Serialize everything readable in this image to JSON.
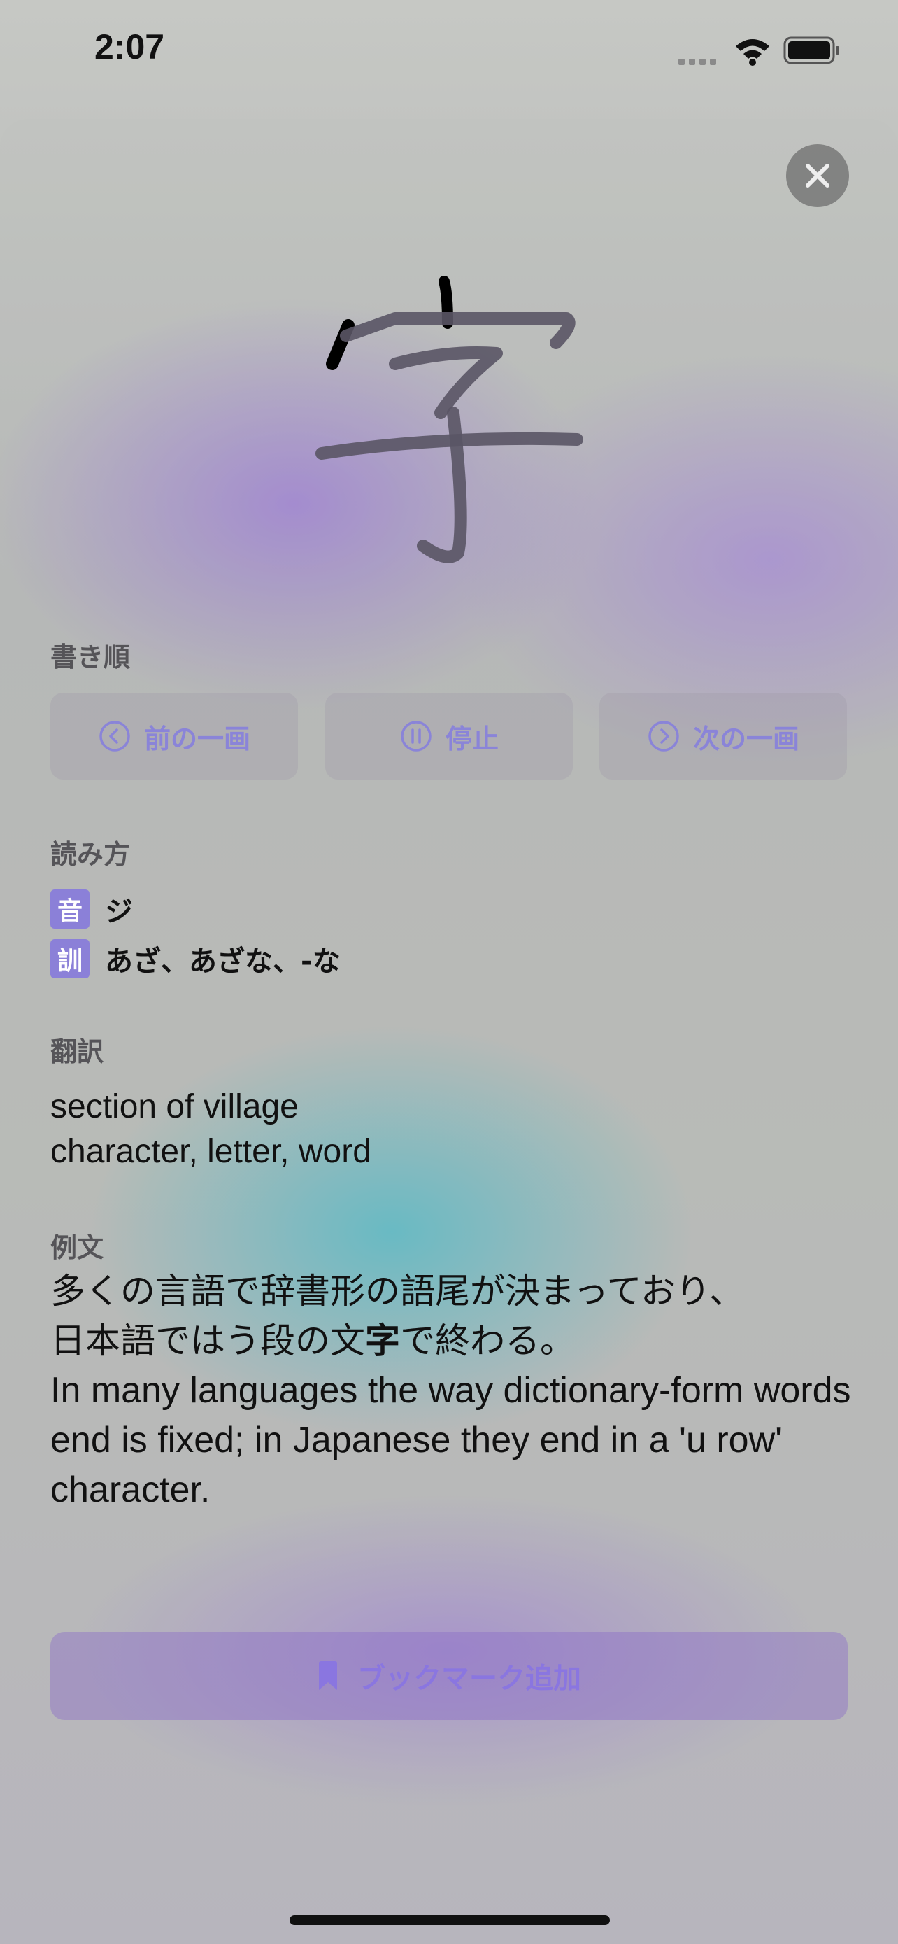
{
  "status_bar": {
    "time": "2:07"
  },
  "kanji": {
    "character": "字"
  },
  "stroke_order": {
    "label": "書き順",
    "prev_label": "前の一画",
    "pause_label": "停止",
    "next_label": "次の一画"
  },
  "readings": {
    "label": "読み方",
    "on": {
      "badge": "音",
      "text": "ジ"
    },
    "kun": {
      "badge": "訓",
      "text": "あざ、あざな、-な"
    }
  },
  "translation": {
    "label": "翻訳",
    "line1": "section of village",
    "line2": "character, letter, word"
  },
  "example": {
    "label": "例文",
    "jp_line1": "多くの言語で辞書形の語尾が決まっており、",
    "jp_line2_before": "日本語ではう段の文",
    "jp_line2_highlight": "字",
    "jp_line2_after": "で終わる。",
    "en": "In many languages the way dictionary-form words end is fixed; in Japanese they end in a 'u row' character."
  },
  "bookmark": {
    "label": "ブックマーク追加"
  },
  "colors": {
    "accent": "#8a84d8",
    "badge": "#8b80d8"
  },
  "icons": {
    "close": "close-icon",
    "prev": "chevron-left-circle-icon",
    "pause": "pause-circle-icon",
    "next": "chevron-right-circle-icon",
    "bookmark": "bookmark-icon"
  }
}
